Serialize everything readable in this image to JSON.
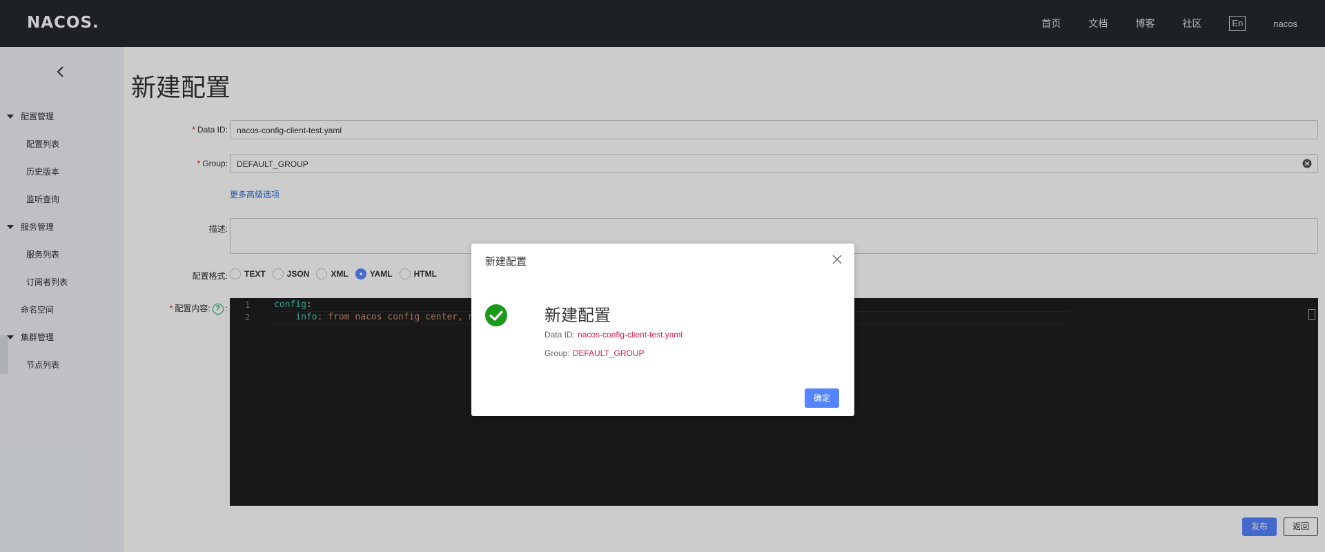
{
  "header": {
    "logo": "NACOS.",
    "nav": [
      "首页",
      "文档",
      "博客",
      "社区"
    ],
    "lang": "En",
    "user": "nacos"
  },
  "sidebar": {
    "groups": [
      {
        "label": "配置管理",
        "items": [
          "配置列表",
          "历史版本",
          "监听查询"
        ]
      },
      {
        "label": "服务管理",
        "items": [
          "服务列表",
          "订阅者列表"
        ]
      },
      {
        "label": "集群管理",
        "items": [
          "节点列表"
        ]
      }
    ],
    "namespace": "命名空间"
  },
  "form": {
    "title": "新建配置",
    "data_id_label": "Data ID:",
    "data_id_value": "nacos-config-client-test.yaml",
    "group_label": "Group:",
    "group_value": "DEFAULT_GROUP",
    "more_options": "更多高级选项",
    "desc_label": "描述:",
    "format_label": "配置格式:",
    "formats": [
      "TEXT",
      "JSON",
      "XML",
      "YAML",
      "HTML"
    ],
    "selected_format": "YAML",
    "content_label": "配置内容:",
    "content_colon": ":",
    "code_lines": [
      {
        "num": "1",
        "key": "config",
        "rest": ":"
      },
      {
        "num": "2",
        "indent": "    ",
        "key": "info",
        "rest": ": from nacos config center, n"
      }
    ],
    "publish": "发布",
    "back": "返回"
  },
  "dialog": {
    "title": "新建配置",
    "heading": "新建配置",
    "data_id_label": "Data ID:",
    "data_id_value": "nacos-config-client-test.yaml",
    "group_label": "Group:",
    "group_value": "DEFAULT_GROUP",
    "ok": "确定"
  },
  "colors": {
    "header_bg": "#252a2f",
    "primary": "#5584ff",
    "success": "#1a9a1a",
    "value_red": "#d81e4a"
  }
}
